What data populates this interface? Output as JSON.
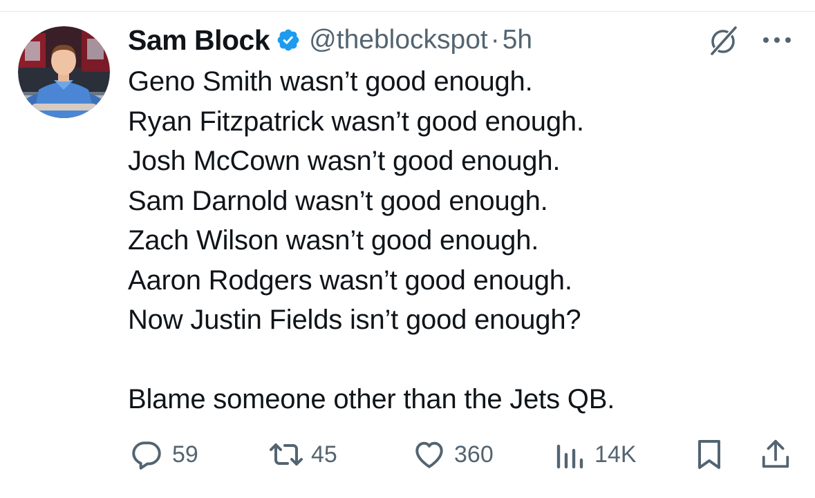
{
  "author": {
    "display_name": "Sam Block",
    "handle": "@theblockspot",
    "separator": "·",
    "time": "5h",
    "verified": true
  },
  "tweet": {
    "lines": [
      "Geno Smith wasn’t good enough.",
      "Ryan Fitzpatrick wasn’t good enough.",
      "Josh McCown wasn’t good enough.",
      "Sam Darnold wasn’t good enough.",
      "Zach Wilson wasn’t good enough.",
      "Aaron Rodgers wasn’t good enough.",
      "Now Justin Fields isn’t good enough?",
      "",
      "Blame someone other than the Jets QB."
    ]
  },
  "actions": {
    "replies": "59",
    "reposts": "45",
    "likes": "360",
    "views": "14K"
  },
  "icons": {
    "verified": "verified-badge-icon",
    "grok": "grok-icon",
    "more": "more-dots-icon",
    "reply": "reply-bubble-icon",
    "repost": "repost-arrows-icon",
    "like": "heart-icon",
    "views": "views-bar-chart-icon",
    "bookmark": "bookmark-icon",
    "share": "share-upload-icon"
  },
  "colors": {
    "text": "#0f1419",
    "secondary": "#536471",
    "verified_blue": "#1d9bf0",
    "divider": "#e6e6e6"
  }
}
